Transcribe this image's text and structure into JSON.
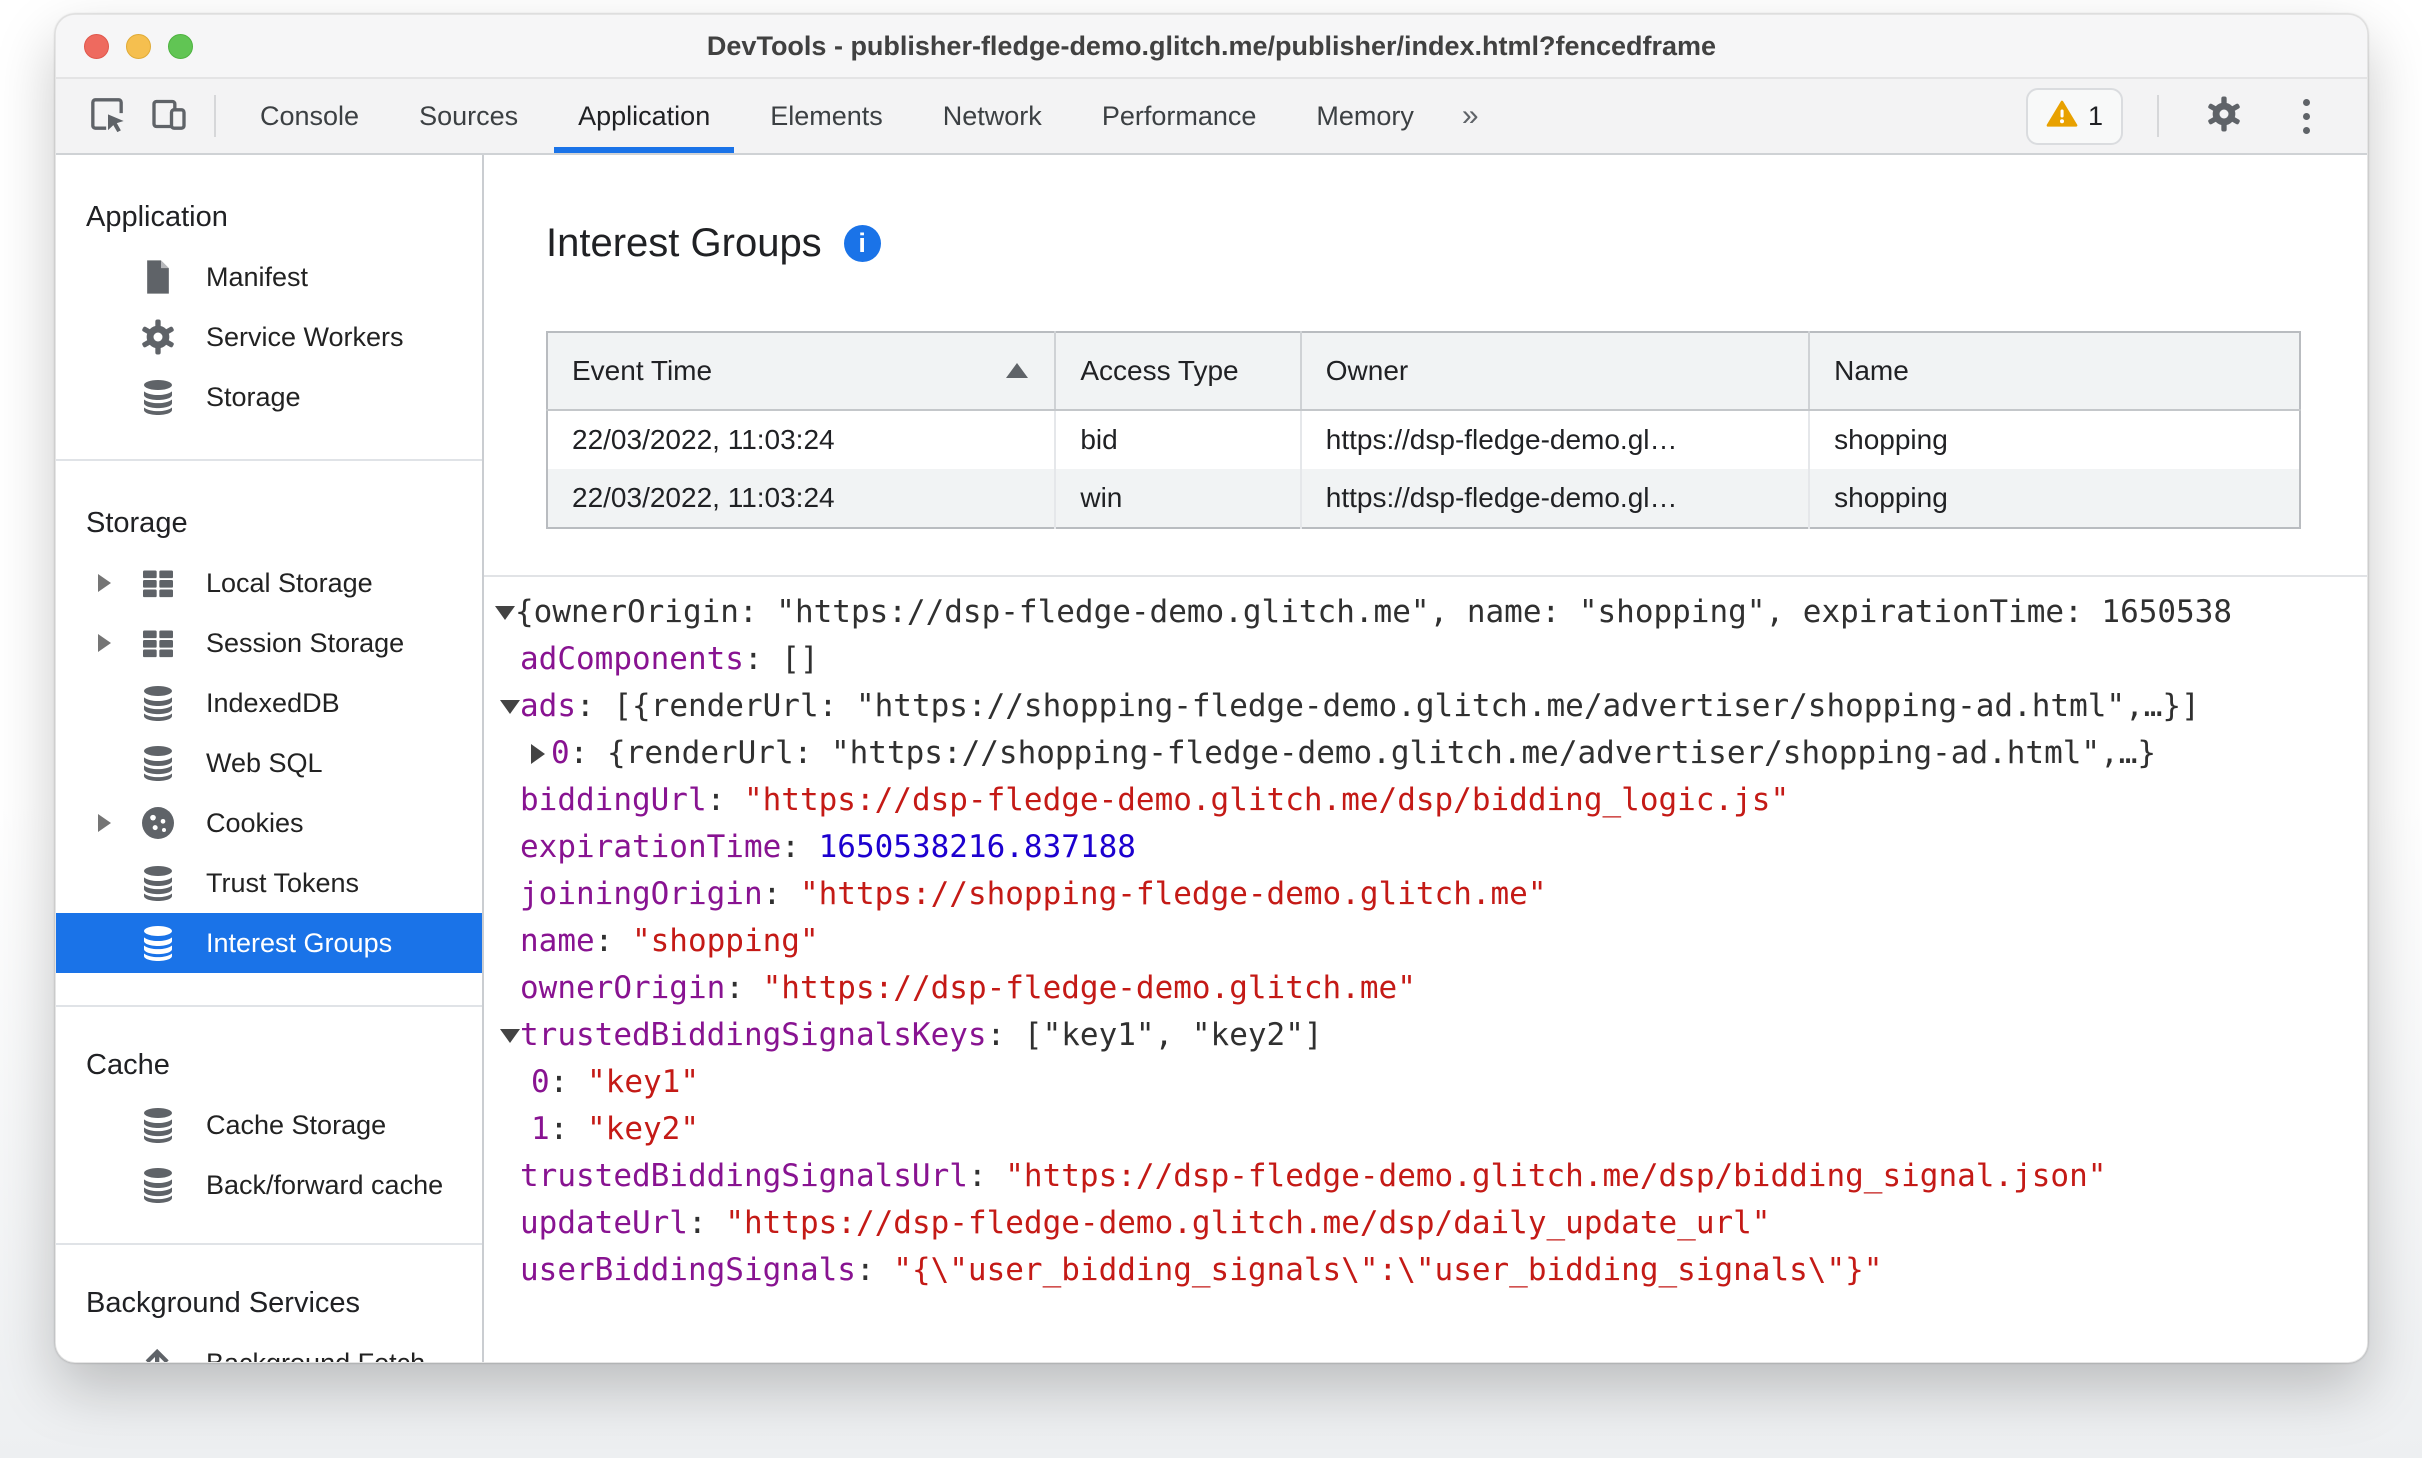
{
  "window": {
    "title": "DevTools - publisher-fledge-demo.glitch.me/publisher/index.html?fencedframe"
  },
  "toolbar": {
    "tabs": [
      "Console",
      "Sources",
      "Application",
      "Elements",
      "Network",
      "Performance",
      "Memory"
    ],
    "active_tab": "Application",
    "more_label": "»",
    "warning_count": "1"
  },
  "sidebar": {
    "sections": [
      {
        "title": "Application",
        "items": [
          {
            "label": "Manifest",
            "icon": "file-icon"
          },
          {
            "label": "Service Workers",
            "icon": "gear-icon"
          },
          {
            "label": "Storage",
            "icon": "database-icon"
          }
        ]
      },
      {
        "title": "Storage",
        "items": [
          {
            "label": "Local Storage",
            "icon": "table-icon",
            "expandable": true
          },
          {
            "label": "Session Storage",
            "icon": "table-icon",
            "expandable": true
          },
          {
            "label": "IndexedDB",
            "icon": "database-icon"
          },
          {
            "label": "Web SQL",
            "icon": "database-icon"
          },
          {
            "label": "Cookies",
            "icon": "cookie-icon",
            "expandable": true
          },
          {
            "label": "Trust Tokens",
            "icon": "database-icon"
          },
          {
            "label": "Interest Groups",
            "icon": "database-icon",
            "selected": true
          }
        ]
      },
      {
        "title": "Cache",
        "items": [
          {
            "label": "Cache Storage",
            "icon": "database-icon"
          },
          {
            "label": "Back/forward cache",
            "icon": "database-icon"
          }
        ]
      },
      {
        "title": "Background Services",
        "items": [
          {
            "label": "Background Fetch",
            "icon": "fetch-icon"
          }
        ]
      }
    ]
  },
  "main": {
    "title": "Interest Groups",
    "info_glyph": "i",
    "table": {
      "columns": [
        "Event Time",
        "Access Type",
        "Owner",
        "Name"
      ],
      "sorted_column": 0,
      "rows": [
        [
          "22/03/2022, 11:03:24",
          "bid",
          "https://dsp-fledge-demo.gl…",
          "shopping"
        ],
        [
          "22/03/2022, 11:03:24",
          "win",
          "https://dsp-fledge-demo.gl…",
          "shopping"
        ]
      ]
    },
    "tree": {
      "lines": [
        {
          "depth": 0,
          "arrow": "down",
          "parts": [
            [
              "plain",
              "{ownerOrigin: \"https://dsp-fledge-demo.glitch.me\", name: \"shopping\", expirationTime: 1650538"
            ]
          ]
        },
        {
          "depth": 1,
          "arrow": "",
          "parts": [
            [
              "key",
              "adComponents"
            ],
            [
              "plain",
              ": []"
            ]
          ]
        },
        {
          "depth": 1,
          "arrow": "down",
          "parts": [
            [
              "key",
              "ads"
            ],
            [
              "plain",
              ": [{renderUrl: \"https://shopping-fledge-demo.glitch.me/advertiser/shopping-ad.html\",…}]"
            ]
          ]
        },
        {
          "depth": 2,
          "arrow": "right",
          "parts": [
            [
              "key",
              "0"
            ],
            [
              "plain",
              ": {renderUrl: \"https://shopping-fledge-demo.glitch.me/advertiser/shopping-ad.html\",…}"
            ]
          ]
        },
        {
          "depth": 1,
          "arrow": "",
          "parts": [
            [
              "key",
              "biddingUrl"
            ],
            [
              "plain",
              ": "
            ],
            [
              "string",
              "\"https://dsp-fledge-demo.glitch.me/dsp/bidding_logic.js\""
            ]
          ]
        },
        {
          "depth": 1,
          "arrow": "",
          "parts": [
            [
              "key",
              "expirationTime"
            ],
            [
              "plain",
              ": "
            ],
            [
              "number",
              "1650538216.837188"
            ]
          ]
        },
        {
          "depth": 1,
          "arrow": "",
          "parts": [
            [
              "key",
              "joiningOrigin"
            ],
            [
              "plain",
              ": "
            ],
            [
              "string",
              "\"https://shopping-fledge-demo.glitch.me\""
            ]
          ]
        },
        {
          "depth": 1,
          "arrow": "",
          "parts": [
            [
              "key",
              "name"
            ],
            [
              "plain",
              ": "
            ],
            [
              "string",
              "\"shopping\""
            ]
          ]
        },
        {
          "depth": 1,
          "arrow": "",
          "parts": [
            [
              "key",
              "ownerOrigin"
            ],
            [
              "plain",
              ": "
            ],
            [
              "string",
              "\"https://dsp-fledge-demo.glitch.me\""
            ]
          ]
        },
        {
          "depth": 1,
          "arrow": "down",
          "parts": [
            [
              "key",
              "trustedBiddingSignalsKeys"
            ],
            [
              "plain",
              ": [\"key1\", \"key2\"]"
            ]
          ]
        },
        {
          "depth": 2,
          "arrow": "",
          "parts": [
            [
              "key",
              "0"
            ],
            [
              "plain",
              ": "
            ],
            [
              "string",
              "\"key1\""
            ]
          ]
        },
        {
          "depth": 2,
          "arrow": "",
          "parts": [
            [
              "key",
              "1"
            ],
            [
              "plain",
              ": "
            ],
            [
              "string",
              "\"key2\""
            ]
          ]
        },
        {
          "depth": 1,
          "arrow": "",
          "parts": [
            [
              "key",
              "trustedBiddingSignalsUrl"
            ],
            [
              "plain",
              ": "
            ],
            [
              "string",
              "\"https://dsp-fledge-demo.glitch.me/dsp/bidding_signal.json\""
            ]
          ]
        },
        {
          "depth": 1,
          "arrow": "",
          "parts": [
            [
              "key",
              "updateUrl"
            ],
            [
              "plain",
              ": "
            ],
            [
              "string",
              "\"https://dsp-fledge-demo.glitch.me/dsp/daily_update_url\""
            ]
          ]
        },
        {
          "depth": 1,
          "arrow": "",
          "parts": [
            [
              "key",
              "userBiddingSignals"
            ],
            [
              "plain",
              ": "
            ],
            [
              "string",
              "\"{\\\"user_bidding_signals\\\":\\\"user_bidding_signals\\\"}\""
            ]
          ]
        }
      ]
    }
  },
  "colors": {
    "accent": "#1a73e8",
    "selected_bg": "#1a73e8",
    "warning": "#e8a100",
    "json_key": "#881391",
    "json_string": "#c41a16",
    "json_number": "#1c00cf",
    "traffic_red": "#ee6a5f",
    "traffic_yellow": "#f5bf4f",
    "traffic_green": "#61c554"
  }
}
